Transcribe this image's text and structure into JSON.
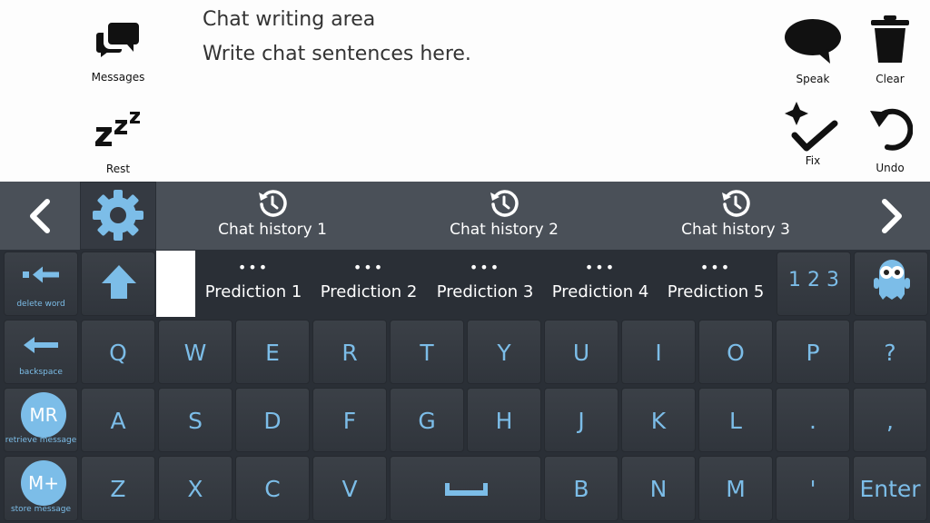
{
  "top": {
    "messages_label": "Messages",
    "rest_label": "Rest",
    "speak_label": "Speak",
    "clear_label": "Clear",
    "fix_label": "Fix",
    "undo_label": "Undo",
    "chat_title": "Chat writing area",
    "chat_placeholder": "Write chat sentences here."
  },
  "history": [
    "Chat history 1",
    "Chat history 2",
    "Chat history 3"
  ],
  "predictions": {
    "items": [
      "Prediction 1",
      "Prediction 2",
      "Prediction 3",
      "Prediction 4",
      "Prediction 5"
    ],
    "dots": "•••"
  },
  "side": {
    "delete_word": "delete word",
    "backspace": "backspace",
    "retrieve_message": "retrieve message",
    "retrieve_abbr": "MR",
    "store_message": "store message",
    "store_abbr": "M+"
  },
  "keys": {
    "numbers": "1 2 3",
    "row1": [
      "Q",
      "W",
      "E",
      "R",
      "T",
      "Y",
      "U",
      "I",
      "O",
      "P",
      "?"
    ],
    "row2": [
      "A",
      "S",
      "D",
      "F",
      "G",
      "H",
      "J",
      "K",
      "L",
      ".",
      ","
    ],
    "row3_left": [
      "Z",
      "X",
      "C",
      "V"
    ],
    "row3_right": [
      "B",
      "N",
      "M",
      "'"
    ],
    "enter": "Enter"
  },
  "colors": {
    "accent": "#7cbde8",
    "key_bg": "#353a42",
    "history_bar": "#4a5058",
    "background": "#2a2f36"
  },
  "icons": {
    "messages": "chat-bubbles-icon",
    "rest": "zzz-icon",
    "speak": "speech-bubble-icon",
    "clear": "trash-icon",
    "fix": "sparkle-check-icon",
    "undo": "undo-icon",
    "settings": "gear-icon",
    "history": "history-clock-icon",
    "profile": "robot-avatar-icon"
  }
}
